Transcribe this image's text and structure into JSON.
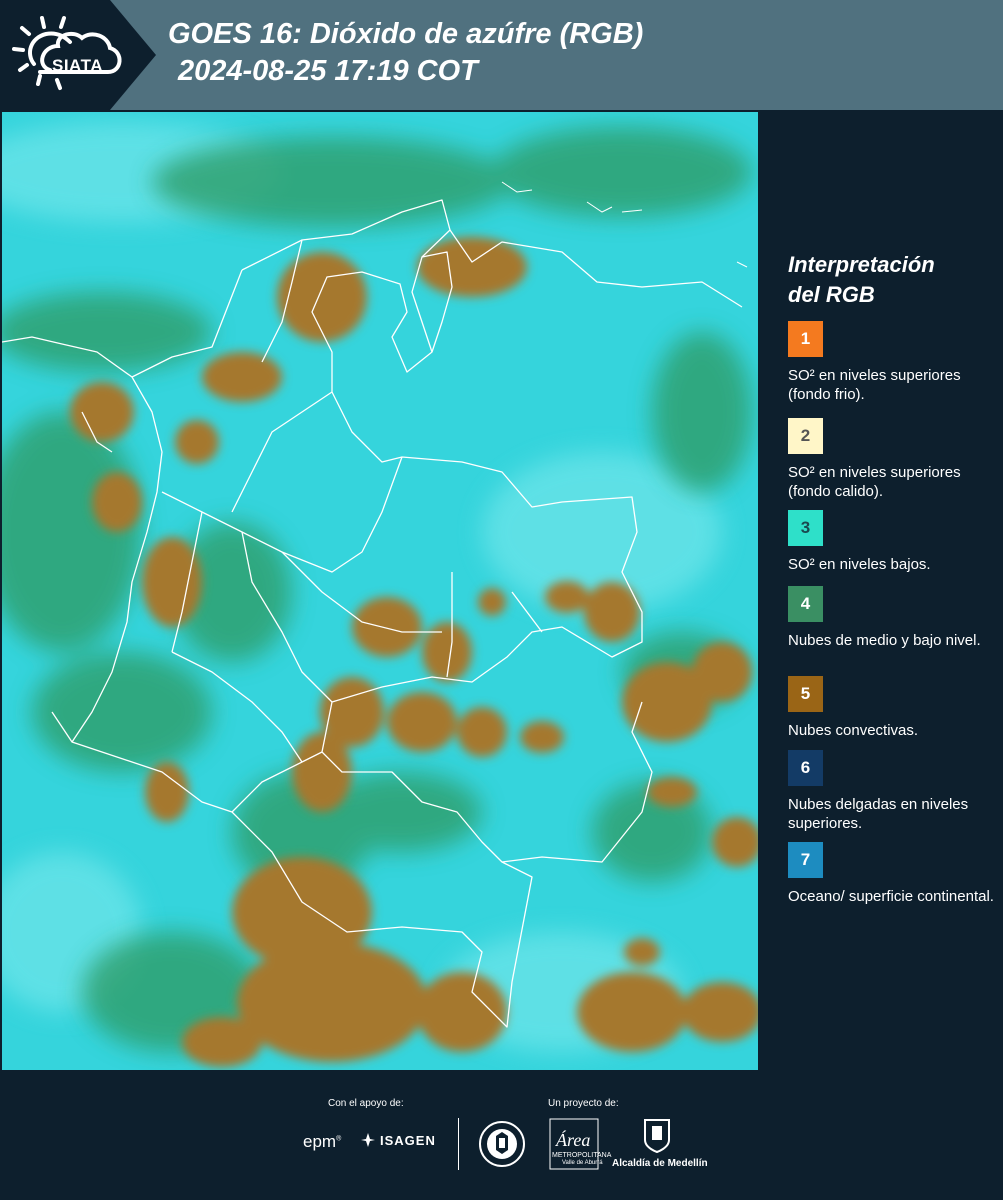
{
  "header": {
    "logo_text": "SIATA",
    "title_line1": "GOES 16: Dióxido de azúfre (RGB)",
    "title_line2": "2024-08-25 17:19 COT"
  },
  "map": {
    "image": "satellite-so2-rgb-composite",
    "colors": {
      "surface": "#35d4dc",
      "low_clouds": "#2f9e6a",
      "convective": "#a5782f",
      "borders": "#ffffff"
    }
  },
  "legend": {
    "title_line1": "Interpretación",
    "title_line2": "del RGB",
    "items": [
      {
        "number": "1",
        "color": "#f47a1f",
        "text_color": "#ffffff",
        "description": "SO² en niveles superiores (fondo frio)."
      },
      {
        "number": "2",
        "color": "#fff6c8",
        "text_color": "#555555",
        "description": "SO² en niveles superiores (fondo calido)."
      },
      {
        "number": "3",
        "color": "#2ee0c9",
        "text_color": "#1a4a50",
        "description": "SO² en niveles bajos."
      },
      {
        "number": "4",
        "color": "#3a8f63",
        "text_color": "#ffffff",
        "description": "Nubes de medio y bajo nivel."
      },
      {
        "number": "5",
        "color": "#9a6516",
        "text_color": "#ffffff",
        "description": "Nubes convectivas."
      },
      {
        "number": "6",
        "color": "#133b66",
        "text_color": "#ffffff",
        "description": "Nubes delgadas en niveles superiores."
      },
      {
        "number": "7",
        "color": "#1d8cc0",
        "text_color": "#ffffff",
        "description": "Oceano/ superficie continental."
      }
    ]
  },
  "footer": {
    "support_label": "Con el apoyo de:",
    "project_label": "Un proyecto de:",
    "epm": "epm",
    "epm_mark": "®",
    "isagen": "ISAGEN",
    "area_logo_text": "Área",
    "area_sub1": "METROPOLITANA",
    "area_sub2": "Valle de Aburrá",
    "alcaldia": "Alcaldía de Medellín"
  }
}
